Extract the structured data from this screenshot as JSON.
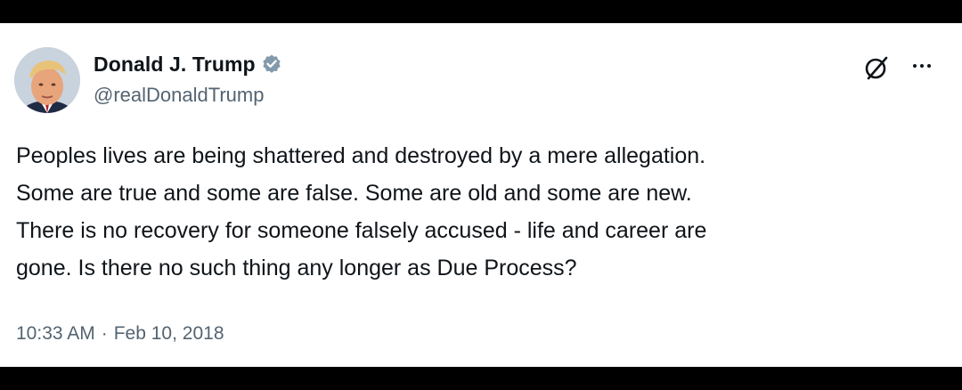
{
  "tweet": {
    "author": {
      "display_name": "Donald J. Trump",
      "handle": "@realDonaldTrump",
      "verified": true,
      "verified_color": "#829aab"
    },
    "text_lines": [
      "Peoples lives are being shattered and destroyed by a mere allegation.",
      "Some are true and some are false. Some are old and some are new.",
      "There is no recovery for someone falsely accused - life and career are",
      "gone. Is there no such thing any longer as Due Process?"
    ],
    "time": "10:33 AM",
    "separator": "·",
    "date": "Feb 10, 2018"
  },
  "icons": {
    "grok": "grok-icon",
    "more": "more-options-icon",
    "verified": "verified-badge-icon"
  },
  "colors": {
    "background": "#ffffff",
    "frame": "#000000",
    "text_primary": "#0f1419",
    "text_secondary": "#536471"
  }
}
